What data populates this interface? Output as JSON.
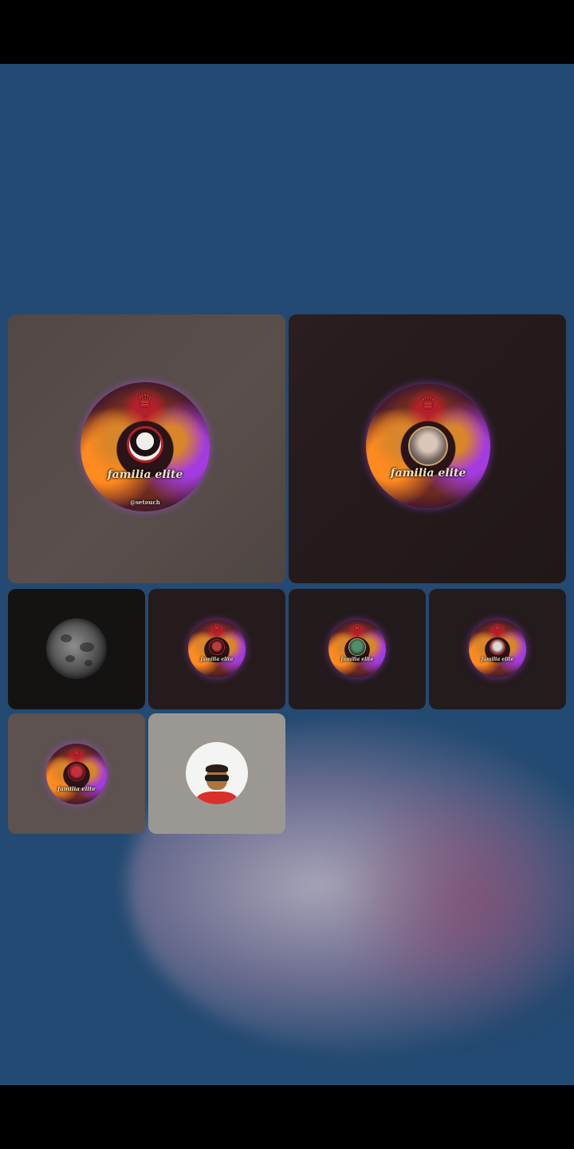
{
  "crest": {
    "title": "familia elite",
    "caption": "@setouch"
  },
  "colors": {
    "background": "#234a72",
    "tile_light": "#514846",
    "tile_dark": "#201718",
    "crest_orange": "#ff8a1f",
    "crest_purple": "#a43be0"
  },
  "participants": [
    {
      "slot": "large-1",
      "avatar": "crest-with-woman-photo"
    },
    {
      "slot": "large-2",
      "avatar": "crest-with-man-photo"
    },
    {
      "slot": "small-1",
      "avatar": "moon-photo"
    },
    {
      "slot": "small-2",
      "avatar": "crest-small"
    },
    {
      "slot": "small-3",
      "avatar": "crest-small"
    },
    {
      "slot": "small-4",
      "avatar": "crest-small"
    },
    {
      "slot": "small-5",
      "avatar": "crest-with-woman-photo"
    },
    {
      "slot": "small-6",
      "avatar": "person-with-sunglasses-photo"
    }
  ]
}
